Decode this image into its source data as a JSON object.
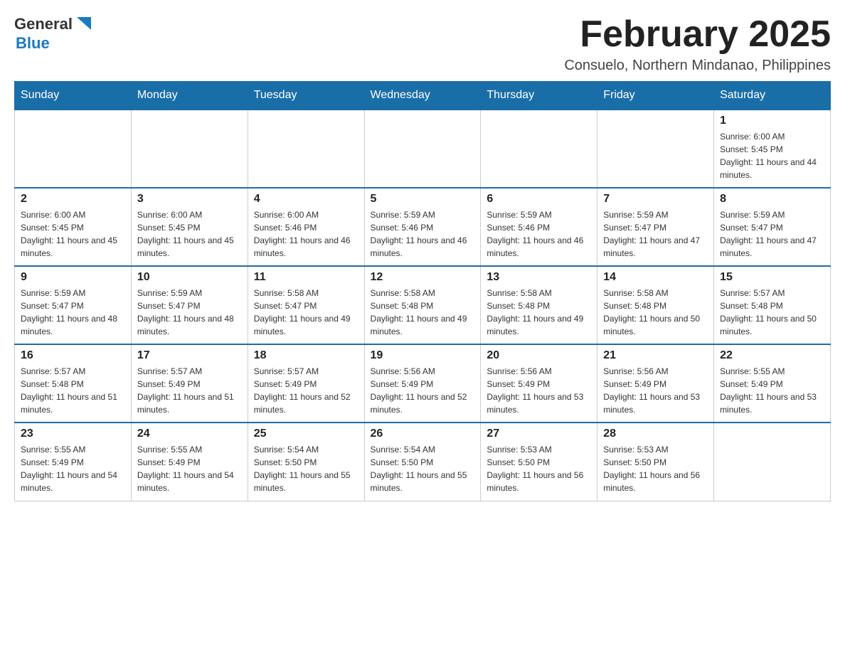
{
  "logo": {
    "text_general": "General",
    "text_blue": "Blue",
    "triangle_color": "#1a7abf"
  },
  "header": {
    "month": "February 2025",
    "location": "Consuelo, Northern Mindanao, Philippines"
  },
  "weekdays": [
    "Sunday",
    "Monday",
    "Tuesday",
    "Wednesday",
    "Thursday",
    "Friday",
    "Saturday"
  ],
  "weeks": [
    [
      {
        "day": "",
        "info": ""
      },
      {
        "day": "",
        "info": ""
      },
      {
        "day": "",
        "info": ""
      },
      {
        "day": "",
        "info": ""
      },
      {
        "day": "",
        "info": ""
      },
      {
        "day": "",
        "info": ""
      },
      {
        "day": "1",
        "info": "Sunrise: 6:00 AM\nSunset: 5:45 PM\nDaylight: 11 hours and 44 minutes."
      }
    ],
    [
      {
        "day": "2",
        "info": "Sunrise: 6:00 AM\nSunset: 5:45 PM\nDaylight: 11 hours and 45 minutes."
      },
      {
        "day": "3",
        "info": "Sunrise: 6:00 AM\nSunset: 5:45 PM\nDaylight: 11 hours and 45 minutes."
      },
      {
        "day": "4",
        "info": "Sunrise: 6:00 AM\nSunset: 5:46 PM\nDaylight: 11 hours and 46 minutes."
      },
      {
        "day": "5",
        "info": "Sunrise: 5:59 AM\nSunset: 5:46 PM\nDaylight: 11 hours and 46 minutes."
      },
      {
        "day": "6",
        "info": "Sunrise: 5:59 AM\nSunset: 5:46 PM\nDaylight: 11 hours and 46 minutes."
      },
      {
        "day": "7",
        "info": "Sunrise: 5:59 AM\nSunset: 5:47 PM\nDaylight: 11 hours and 47 minutes."
      },
      {
        "day": "8",
        "info": "Sunrise: 5:59 AM\nSunset: 5:47 PM\nDaylight: 11 hours and 47 minutes."
      }
    ],
    [
      {
        "day": "9",
        "info": "Sunrise: 5:59 AM\nSunset: 5:47 PM\nDaylight: 11 hours and 48 minutes."
      },
      {
        "day": "10",
        "info": "Sunrise: 5:59 AM\nSunset: 5:47 PM\nDaylight: 11 hours and 48 minutes."
      },
      {
        "day": "11",
        "info": "Sunrise: 5:58 AM\nSunset: 5:47 PM\nDaylight: 11 hours and 49 minutes."
      },
      {
        "day": "12",
        "info": "Sunrise: 5:58 AM\nSunset: 5:48 PM\nDaylight: 11 hours and 49 minutes."
      },
      {
        "day": "13",
        "info": "Sunrise: 5:58 AM\nSunset: 5:48 PM\nDaylight: 11 hours and 49 minutes."
      },
      {
        "day": "14",
        "info": "Sunrise: 5:58 AM\nSunset: 5:48 PM\nDaylight: 11 hours and 50 minutes."
      },
      {
        "day": "15",
        "info": "Sunrise: 5:57 AM\nSunset: 5:48 PM\nDaylight: 11 hours and 50 minutes."
      }
    ],
    [
      {
        "day": "16",
        "info": "Sunrise: 5:57 AM\nSunset: 5:48 PM\nDaylight: 11 hours and 51 minutes."
      },
      {
        "day": "17",
        "info": "Sunrise: 5:57 AM\nSunset: 5:49 PM\nDaylight: 11 hours and 51 minutes."
      },
      {
        "day": "18",
        "info": "Sunrise: 5:57 AM\nSunset: 5:49 PM\nDaylight: 11 hours and 52 minutes."
      },
      {
        "day": "19",
        "info": "Sunrise: 5:56 AM\nSunset: 5:49 PM\nDaylight: 11 hours and 52 minutes."
      },
      {
        "day": "20",
        "info": "Sunrise: 5:56 AM\nSunset: 5:49 PM\nDaylight: 11 hours and 53 minutes."
      },
      {
        "day": "21",
        "info": "Sunrise: 5:56 AM\nSunset: 5:49 PM\nDaylight: 11 hours and 53 minutes."
      },
      {
        "day": "22",
        "info": "Sunrise: 5:55 AM\nSunset: 5:49 PM\nDaylight: 11 hours and 53 minutes."
      }
    ],
    [
      {
        "day": "23",
        "info": "Sunrise: 5:55 AM\nSunset: 5:49 PM\nDaylight: 11 hours and 54 minutes."
      },
      {
        "day": "24",
        "info": "Sunrise: 5:55 AM\nSunset: 5:49 PM\nDaylight: 11 hours and 54 minutes."
      },
      {
        "day": "25",
        "info": "Sunrise: 5:54 AM\nSunset: 5:50 PM\nDaylight: 11 hours and 55 minutes."
      },
      {
        "day": "26",
        "info": "Sunrise: 5:54 AM\nSunset: 5:50 PM\nDaylight: 11 hours and 55 minutes."
      },
      {
        "day": "27",
        "info": "Sunrise: 5:53 AM\nSunset: 5:50 PM\nDaylight: 11 hours and 56 minutes."
      },
      {
        "day": "28",
        "info": "Sunrise: 5:53 AM\nSunset: 5:50 PM\nDaylight: 11 hours and 56 minutes."
      },
      {
        "day": "",
        "info": ""
      }
    ]
  ]
}
